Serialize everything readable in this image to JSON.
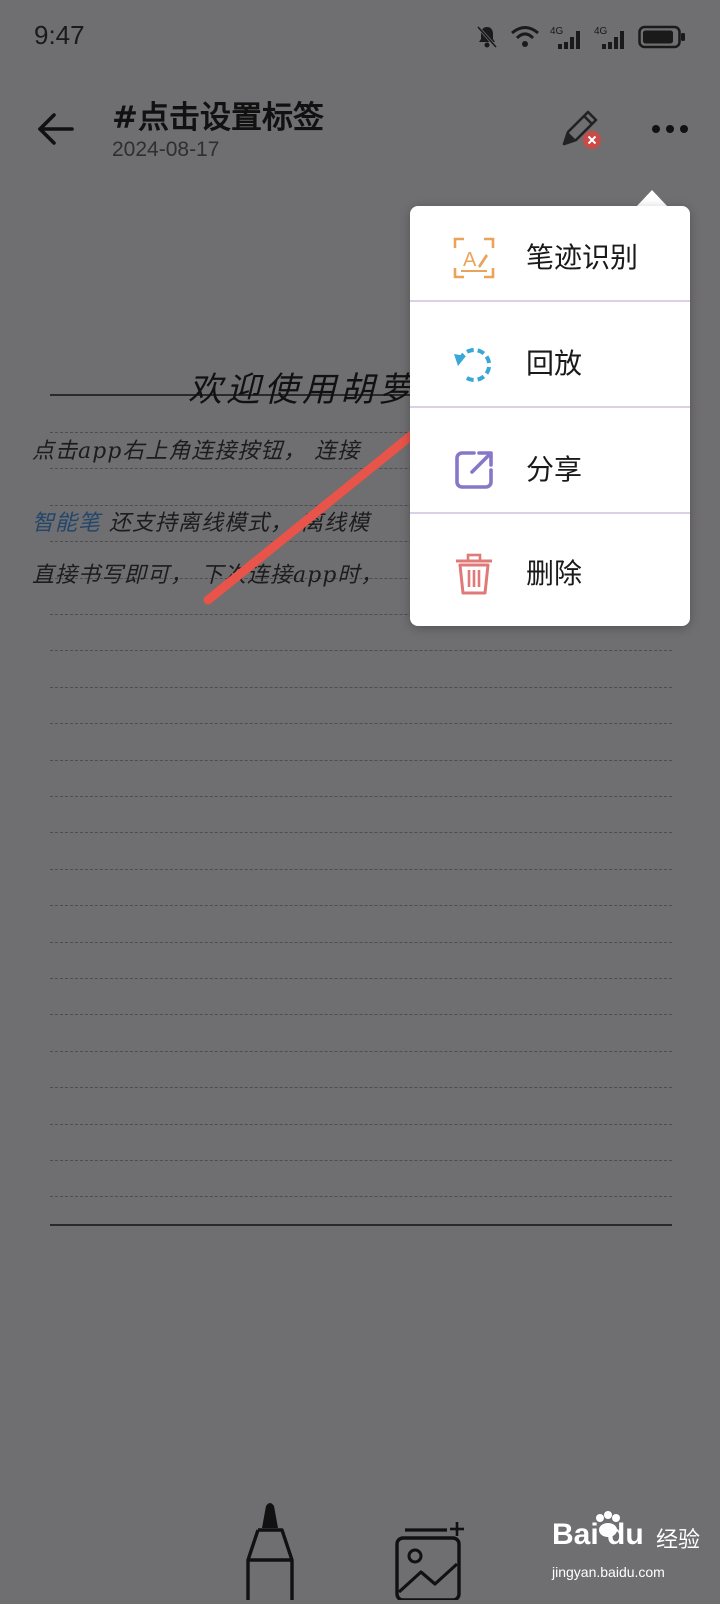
{
  "status_bar": {
    "time": "9:47",
    "network_1": "4G",
    "network_2": "4G"
  },
  "header": {
    "title": "#点击设置标签",
    "date": "2024-08-17"
  },
  "note": {
    "title": "欢迎使用胡萝",
    "lines": [
      {
        "text": "点击app右上角连接按钮， 连接"
      },
      {
        "accent": "智能笔",
        "text": " 还支持离线模式， 离线模"
      },
      {
        "text": "直接书写即可， 下次连接app时，"
      }
    ]
  },
  "menu": {
    "items": [
      {
        "label": "笔迹识别",
        "icon": "handwriting-recognition-icon",
        "color": "#e8a55a"
      },
      {
        "label": "回放",
        "icon": "replay-icon",
        "color": "#3aa7d9"
      },
      {
        "label": "分享",
        "icon": "share-icon",
        "color": "#8677c9"
      },
      {
        "label": "删除",
        "icon": "delete-icon",
        "color": "#e07a78"
      }
    ]
  },
  "annotation": {
    "arrow_color": "#e8534a"
  },
  "watermark": {
    "brand": "Bai du",
    "text": "经验",
    "url": "jingyan.baidu.com"
  }
}
